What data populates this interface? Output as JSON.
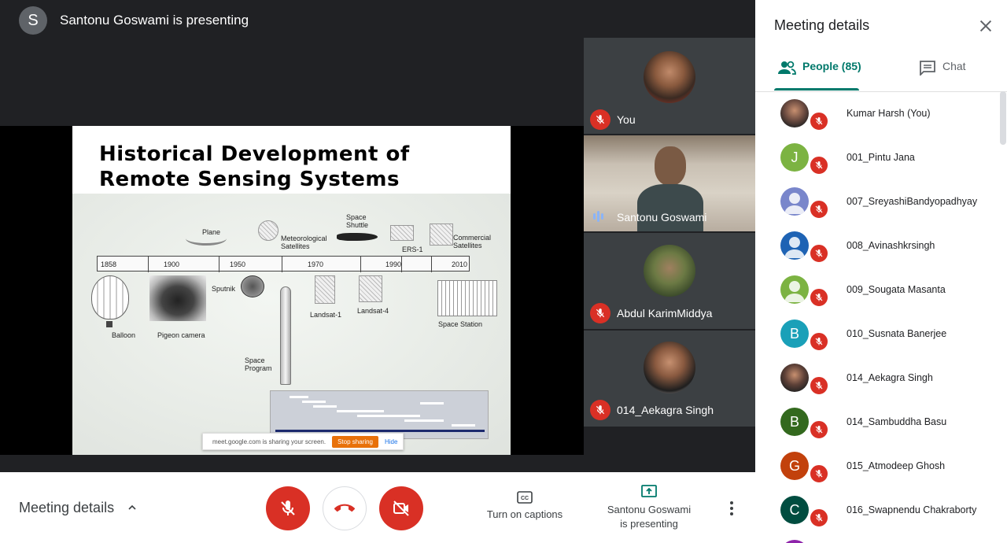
{
  "presenter": {
    "initial": "S",
    "text": "Santonu Goswami is presenting"
  },
  "slide": {
    "title_line1": "Historical Development of",
    "title_line2": "Remote Sensing Systems",
    "years": [
      "1858",
      "1900",
      "1950",
      "1970",
      "1990",
      "2010"
    ],
    "labels": {
      "plane": "Plane",
      "met_sat": "Meteorological\nSatellites",
      "shuttle": "Space\nShuttle",
      "ers": "ERS-1",
      "commercial": "Commercial\nSatellites",
      "sputnik": "Sputnik",
      "balloon": "Balloon",
      "pigeon": "Pigeon camera",
      "landsat1": "Landsat-1",
      "landsat4": "Landsat-4",
      "station": "Space Station",
      "space_program": "Space\nProgram"
    },
    "share_bar": {
      "text": "meet.google.com is sharing your screen.",
      "stop": "Stop sharing",
      "hide": "Hide"
    }
  },
  "tiles": [
    {
      "name": "You",
      "state": "muted"
    },
    {
      "name": "Santonu Goswami",
      "state": "speaking"
    },
    {
      "name": "Abdul KarimMiddya",
      "state": "muted"
    },
    {
      "name": "014_Aekagra Singh",
      "state": "muted"
    }
  ],
  "bottom_bar": {
    "meeting_details": "Meeting details",
    "captions": "Turn on captions",
    "presenting_line1": "Santonu Goswami",
    "presenting_line2": "is presenting"
  },
  "panel": {
    "title": "Meeting details",
    "people_tab": "People (85)",
    "chat_tab": "Chat",
    "people": [
      {
        "name": "Kumar Harsh (You)",
        "initial": "",
        "color": "#6d4c41",
        "photo": true
      },
      {
        "name": "001_Pintu Jana",
        "initial": "J",
        "color": "#7cb342",
        "photo": false
      },
      {
        "name": "007_SreyashiBandyopadhyay",
        "initial": "",
        "color": "#7986cb",
        "photo": false,
        "silhouette": true
      },
      {
        "name": "008_Avinashkrsingh",
        "initial": "",
        "color": "#1e63b4",
        "photo": false,
        "silhouette": true
      },
      {
        "name": "009_Sougata Masanta",
        "initial": "",
        "color": "#7cb342",
        "photo": false,
        "silhouette": true
      },
      {
        "name": "010_Susnata Banerjee",
        "initial": "B",
        "color": "#1aa0b8",
        "photo": false
      },
      {
        "name": "014_Aekagra Singh",
        "initial": "",
        "color": "#5d4037",
        "photo": true
      },
      {
        "name": "014_Sambuddha Basu",
        "initial": "B",
        "color": "#33691e",
        "photo": false
      },
      {
        "name": "015_Atmodeep Ghosh",
        "initial": "G",
        "color": "#c2410c",
        "photo": false
      },
      {
        "name": "016_Swapnendu Chakraborty",
        "initial": "C",
        "color": "#004d40",
        "photo": false
      }
    ]
  },
  "colors": {
    "danger": "#d93025",
    "accent": "#00796b",
    "dark": "#202124"
  }
}
